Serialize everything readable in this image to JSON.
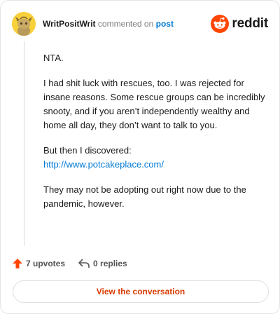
{
  "header": {
    "username": "WritPositWrit",
    "action_text": "commented on",
    "post_link": "post",
    "brand": "reddit",
    "brand_color": "#ff4500"
  },
  "comment": {
    "paragraphs": [
      "NTA.",
      "I had shit luck with rescues, too. I was rejected for insane reasons. Some rescue groups can be incredibly snooty, and if you aren’t independently wealthy and home all day, they don’t want to talk to you.",
      "But then I discovered:",
      "They may not be adopting out right now due to the pandemic, however."
    ],
    "link_text": "http://www.potcakeplace.com/"
  },
  "footer": {
    "upvotes": "7 upvotes",
    "replies": "0 replies",
    "upvote_icon": "upvote-arrow-icon",
    "reply_icon": "reply-arrow-icon"
  },
  "cta": {
    "label": "View the conversation",
    "color": "#d93a00"
  }
}
